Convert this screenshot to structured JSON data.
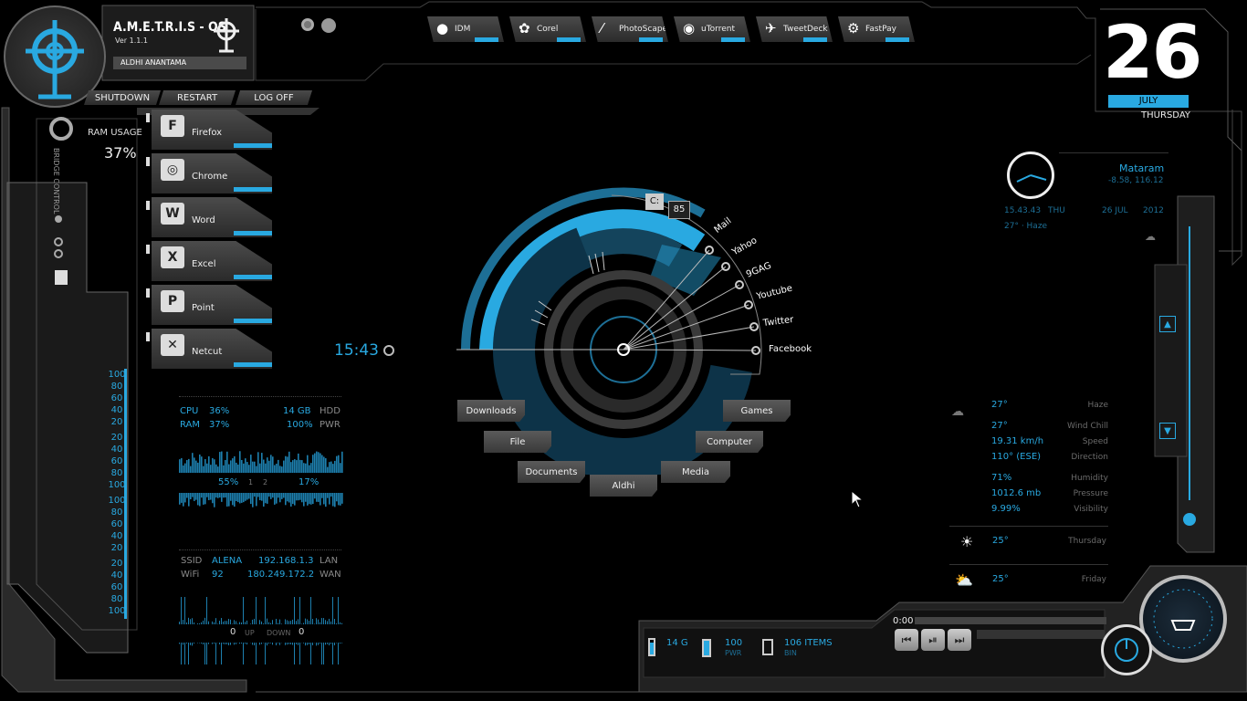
{
  "os": {
    "name": "A.M.E.T.R.I.S - OS",
    "version": "Ver 1.1.1",
    "user": "ALDHI ANANTAMA"
  },
  "power": {
    "shutdown": "SHUTDOWN",
    "restart": "RESTART",
    "logoff": "LOG OFF"
  },
  "ram": {
    "label": "RAM USAGE",
    "value": "37%"
  },
  "side_label": "BRIDGE CONTROL",
  "top_launchers": [
    {
      "label": "IDM"
    },
    {
      "label": "Corel"
    },
    {
      "label": "PhotoScape"
    },
    {
      "label": "uTorrent"
    },
    {
      "label": "TweetDeck"
    },
    {
      "label": "FastPay"
    }
  ],
  "apps": [
    {
      "label": "Firefox",
      "icon": "firefox-icon"
    },
    {
      "label": "Chrome",
      "icon": "chrome-icon"
    },
    {
      "label": "Word",
      "icon": "word-icon"
    },
    {
      "label": "Excel",
      "icon": "excel-icon"
    },
    {
      "label": "Point",
      "icon": "powerpoint-icon"
    },
    {
      "label": "Netcut",
      "icon": "netcut-icon"
    }
  ],
  "scale_values": [
    "100",
    "80",
    "60",
    "40",
    "20",
    "20",
    "40",
    "60",
    "80",
    "100",
    "100",
    "80",
    "60",
    "40",
    "20",
    "20",
    "40",
    "60",
    "80",
    "100"
  ],
  "system": {
    "cpu_label": "CPU",
    "cpu_val": "36%",
    "hdd_val": "14 GB",
    "hdd_label": "HDD",
    "ram_label": "RAM",
    "ram_val": "37%",
    "pwr_val": "100%",
    "pwr_label": "PWR",
    "core1": "55%",
    "core1_idx": "1",
    "core2_idx": "2",
    "core2": "17%"
  },
  "network": {
    "ssid_label": "SSID",
    "ssid": "ALENA",
    "lan_ip": "192.168.1.3",
    "lan_label": "LAN",
    "wifi_label": "WiFi",
    "wifi": "92",
    "wan_ip": "180.249.172.2",
    "wan_label": "WAN",
    "up": "0",
    "up_label": "UP",
    "down_label": "DOWN",
    "down": "0"
  },
  "clock": {
    "time": "15:43"
  },
  "drive": {
    "letter": "C:",
    "value": "85"
  },
  "links": [
    "Mail",
    "Yahoo",
    "9GAG",
    "Youtube",
    "Twitter",
    "Facebook"
  ],
  "folders": [
    "Downloads",
    "File",
    "Documents",
    "Aldhi",
    "Media",
    "Computer",
    "Games"
  ],
  "date": {
    "day": "26",
    "month": "JULY",
    "weekday": "THURSDAY"
  },
  "location": {
    "city": "Mataram",
    "coords": "-8.58, 116.12",
    "time": "15.43.43",
    "dow": "THU",
    "date": "26 JUL",
    "year": "2012",
    "summary": "27° · Haze"
  },
  "weather": {
    "rows": [
      {
        "value": "27°",
        "label": "Haze"
      },
      {
        "value": "27°",
        "label": "Wind Chill"
      },
      {
        "value": "19.31 km/h",
        "label": "Speed"
      },
      {
        "value": "110° (ESE)",
        "label": "Direction"
      },
      {
        "value": "71%",
        "label": "Humidity"
      },
      {
        "value": "1012.6 mb",
        "label": "Pressure"
      },
      {
        "value": "9.99%",
        "label": "Visibility"
      }
    ],
    "forecast": [
      {
        "value": "25°",
        "label": "Thursday"
      },
      {
        "value": "25°",
        "label": "Friday"
      }
    ]
  },
  "player": {
    "time": "0:00"
  },
  "status": {
    "disk": "14 G",
    "battery": "100",
    "battery_label": "PWR",
    "bin": "106 ITEMS",
    "bin_label": "BIN"
  },
  "accent": "#29a9e1"
}
